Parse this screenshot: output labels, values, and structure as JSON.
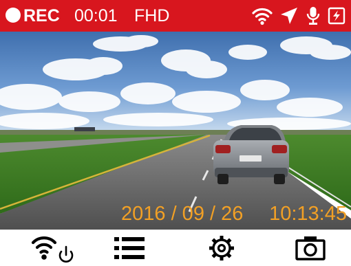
{
  "status_bar": {
    "rec_label": "REC",
    "elapsed": "00:01",
    "quality": "FHD",
    "background": "#d8161e",
    "icons": [
      "wifi-icon",
      "gps-arrow-icon",
      "microphone-icon",
      "power-icon"
    ]
  },
  "camera_view": {
    "date": "2016 / 09 / 26",
    "time": "10:13:45",
    "overlay_color": "#f2a025"
  },
  "toolbar": {
    "buttons": [
      "wifi-power-button",
      "menu-button",
      "settings-button",
      "camera-button"
    ]
  }
}
